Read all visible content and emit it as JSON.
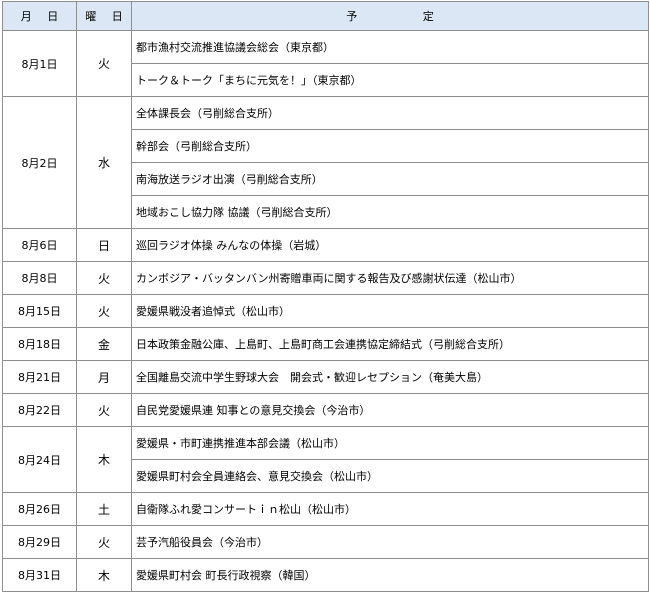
{
  "header": {
    "date": "月 日",
    "day": "曜 日",
    "plan": "予 定"
  },
  "rows": [
    {
      "date": "8月1日",
      "day": "火",
      "items": [
        "都市漁村交流推進協議会総会（東京都）",
        "トーク＆トーク「まちに元気を！」（東京都）"
      ]
    },
    {
      "date": "8月2日",
      "day": "水",
      "items": [
        "全体課長会（弓削総合支所）",
        "幹部会（弓削総合支所）",
        "南海放送ラジオ出演（弓削総合支所）",
        "地域おこし協力隊 協議（弓削総合支所）"
      ]
    },
    {
      "date": "8月6日",
      "day": "日",
      "items": [
        "巡回ラジオ体操 みんなの体操（岩城）"
      ]
    },
    {
      "date": "8月8日",
      "day": "火",
      "items": [
        "カンボジア・バッタンバン州寄贈車両に関する報告及び感謝状伝達（松山市）"
      ]
    },
    {
      "date": "8月15日",
      "day": "火",
      "items": [
        "愛媛県戦没者追悼式（松山市）"
      ]
    },
    {
      "date": "8月18日",
      "day": "金",
      "items": [
        "日本政策金融公庫、上島町、上島町商工会連携協定締結式（弓削総合支所）"
      ]
    },
    {
      "date": "8月21日",
      "day": "月",
      "items": [
        "全国離島交流中学生野球大会　開会式・歓迎レセプション（奄美大島）"
      ]
    },
    {
      "date": "8月22日",
      "day": "火",
      "items": [
        "自民党愛媛県連 知事との意見交換会（今治市）"
      ]
    },
    {
      "date": "8月24日",
      "day": "木",
      "items": [
        "愛媛県・市町連携推進本部会議（松山市）",
        "愛媛県町村会全員連絡会、意見交換会（松山市）"
      ]
    },
    {
      "date": "8月26日",
      "day": "土",
      "items": [
        "自衛隊ふれ愛コンサートｉｎ松山（松山市）"
      ]
    },
    {
      "date": "8月29日",
      "day": "火",
      "items": [
        "芸予汽船役員会（今治市）"
      ]
    },
    {
      "date": "8月31日",
      "day": "木",
      "items": [
        "愛媛県町村会 町長行政視察（韓国）"
      ]
    }
  ]
}
